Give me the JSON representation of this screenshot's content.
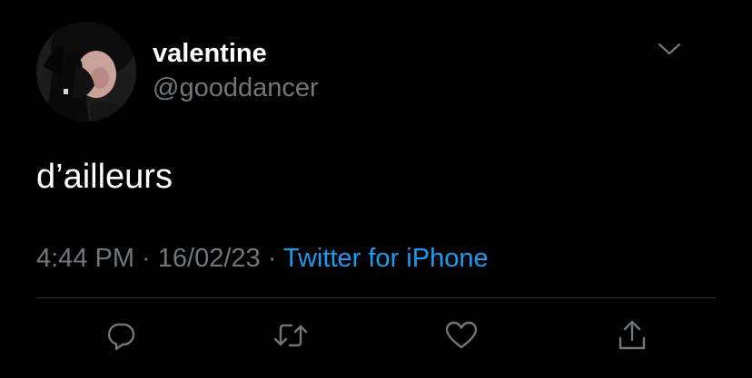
{
  "tweet": {
    "author": {
      "display_name": "valentine",
      "handle": "@gooddancer",
      "avatar": "profile-photo"
    },
    "text": "d’ailleurs",
    "time": "4:44 PM",
    "separator": " · ",
    "date": "16/02/23",
    "source": "Twitter for iPhone"
  },
  "actions": {
    "reply_icon": "reply-icon",
    "retweet_icon": "retweet-icon",
    "like_icon": "like-icon",
    "share_icon": "share-icon"
  },
  "menu_icon": "chevron-down-icon",
  "colors": {
    "background": "#000000",
    "primary_text": "#ffffff",
    "secondary_text": "#71767b",
    "link": "#1d9bf0",
    "divider": "#2f3336"
  }
}
